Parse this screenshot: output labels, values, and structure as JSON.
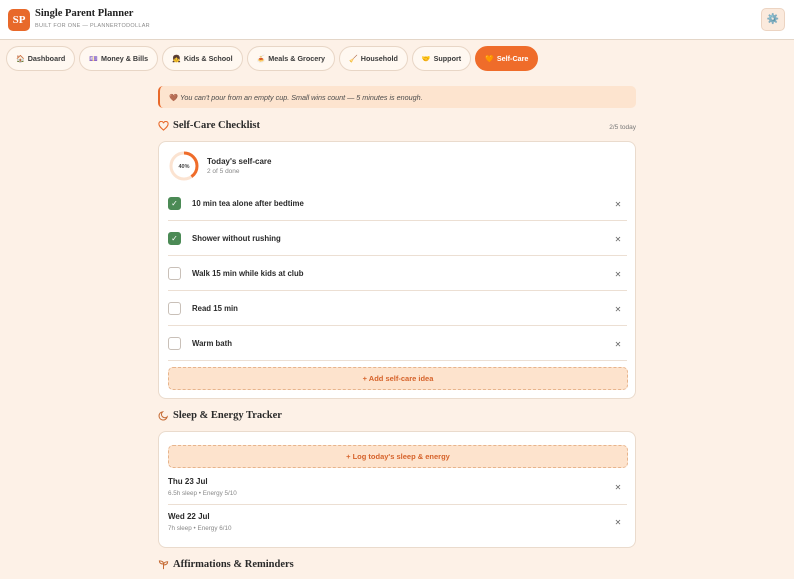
{
  "header": {
    "logo_text": "SP",
    "title": "Single Parent Planner",
    "subtitle": "BUILT FOR ONE — PLANNERTODOLLAR",
    "settings_icon": "⚙️"
  },
  "tabs": [
    {
      "icon": "🏠",
      "label": "Dashboard"
    },
    {
      "icon": "💷",
      "label": "Money & Bills"
    },
    {
      "icon": "👧",
      "label": "Kids & School"
    },
    {
      "icon": "🍝",
      "label": "Meals & Grocery"
    },
    {
      "icon": "🧹",
      "label": "Household"
    },
    {
      "icon": "🤝",
      "label": "Support"
    },
    {
      "icon": "🧡",
      "label": "Self-Care",
      "active": true
    }
  ],
  "banner": {
    "icon": "🤎",
    "text": "You can't pour from an empty cup. Small wins count — 5 minutes is enough."
  },
  "selfcare": {
    "heading": "Self-Care Checklist",
    "count": "2/5 today",
    "progress_label": "40%",
    "progress_value": 0.4,
    "summary_title": "Today's self-care",
    "summary_sub": "2 of 5 done",
    "items": [
      {
        "label": "10 min tea alone after bedtime",
        "done": true
      },
      {
        "label": "Shower without rushing",
        "done": true
      },
      {
        "label": "Walk 15 min while kids at club",
        "done": false
      },
      {
        "label": "Read 15 min",
        "done": false
      },
      {
        "label": "Warm bath",
        "done": false
      }
    ],
    "add_label": "+ Add self-care idea"
  },
  "sleep": {
    "heading": "Sleep & Energy Tracker",
    "log_label": "+ Log today's sleep & energy",
    "entries": [
      {
        "date": "Thu 23 Jul",
        "meta": "6.5h sleep • Energy 5/10"
      },
      {
        "date": "Wed 22 Jul",
        "meta": "7h sleep • Energy 6/10"
      }
    ]
  },
  "affirmations": {
    "heading": "Affirmations & Reminders"
  },
  "colors": {
    "accent": "#ef6c2a",
    "check": "#4b8a55",
    "ring_track": "#fbe3d1"
  },
  "icons": {
    "delete": "✕",
    "check": "✓"
  }
}
